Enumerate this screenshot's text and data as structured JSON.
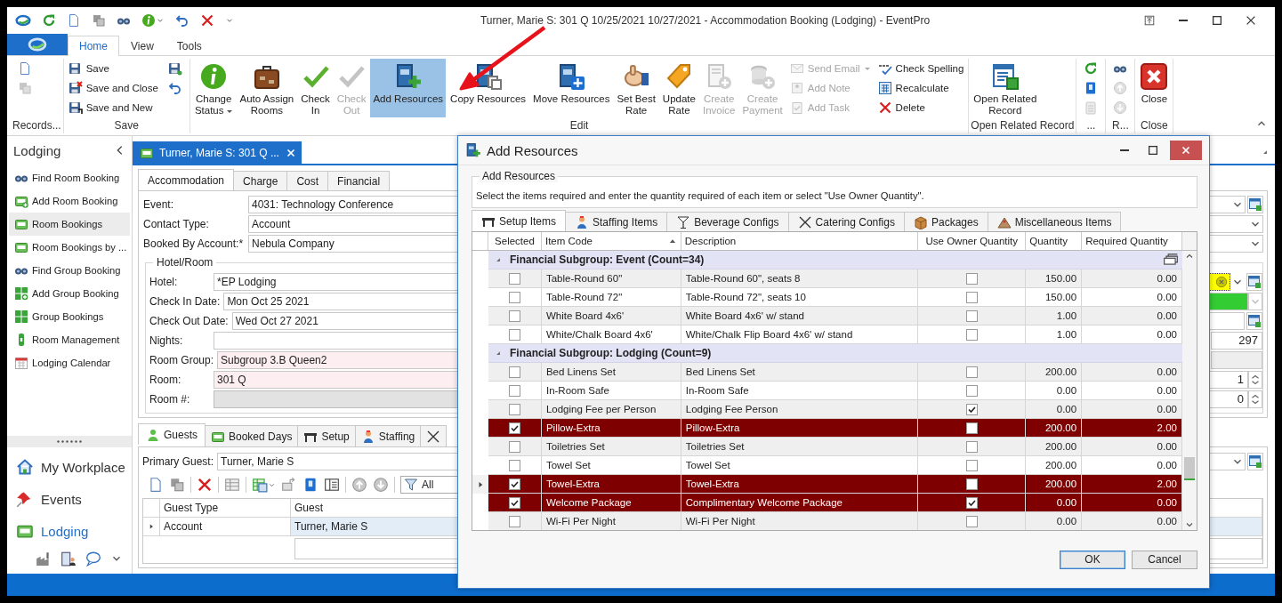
{
  "window": {
    "title": "Turner, Marie S: 301 Q 10/25/2021 10/27/2021 - Accommodation Booking (Lodging) - EventPro"
  },
  "ribbon_tabs": [
    {
      "label": "Home",
      "selected": true
    },
    {
      "label": "View",
      "selected": false
    },
    {
      "label": "Tools",
      "selected": false
    }
  ],
  "ribbon_groups": [
    {
      "label": "Records...",
      "columns": [
        [
          {
            "kind": "icon",
            "disabled": false
          },
          {
            "kind": "icon",
            "disabled": true
          }
        ]
      ]
    },
    {
      "label": "Save",
      "columns": [
        [
          {
            "kind": "small",
            "label": "Save",
            "disabled": false,
            "dropdown": false
          },
          {
            "kind": "small",
            "label": "Save and Close",
            "disabled": false,
            "dropdown": false
          },
          {
            "kind": "small",
            "label": "Save and New",
            "disabled": false,
            "dropdown": false
          }
        ],
        [
          {
            "kind": "icon",
            "disabled": false
          },
          {
            "kind": "icon",
            "disabled": false
          }
        ]
      ]
    },
    {
      "label": "Edit",
      "columns": [
        [
          {
            "kind": "large",
            "lines": [
              "Change",
              "Status"
            ],
            "disabled": false,
            "dropdown": true,
            "highlighted": false
          }
        ],
        [
          {
            "kind": "large",
            "lines": [
              "Auto Assign",
              "Rooms"
            ],
            "disabled": false,
            "dropdown": false,
            "highlighted": false
          }
        ],
        [
          {
            "kind": "large",
            "lines": [
              "Check",
              "In"
            ],
            "disabled": false,
            "dropdown": false,
            "highlighted": false
          }
        ],
        [
          {
            "kind": "large",
            "lines": [
              "Check",
              "Out"
            ],
            "disabled": true,
            "dropdown": false,
            "highlighted": false
          }
        ],
        [
          {
            "kind": "large",
            "lines": [
              "Add Resources"
            ],
            "disabled": false,
            "dropdown": false,
            "highlighted": true
          }
        ],
        [
          {
            "kind": "large",
            "lines": [
              "Copy Resources"
            ],
            "disabled": false,
            "dropdown": false,
            "highlighted": false
          }
        ],
        [
          {
            "kind": "large",
            "lines": [
              "Move Resources"
            ],
            "disabled": false,
            "dropdown": false,
            "highlighted": false
          }
        ],
        [
          {
            "kind": "large",
            "lines": [
              "Set Best",
              "Rate"
            ],
            "disabled": false,
            "dropdown": false,
            "highlighted": false
          }
        ],
        [
          {
            "kind": "large",
            "lines": [
              "Update",
              "Rate"
            ],
            "disabled": false,
            "dropdown": false,
            "highlighted": false
          }
        ],
        [
          {
            "kind": "large",
            "lines": [
              "Create",
              "Invoice"
            ],
            "disabled": true,
            "dropdown": false,
            "highlighted": false
          }
        ],
        [
          {
            "kind": "large",
            "lines": [
              "Create",
              "Payment"
            ],
            "disabled": true,
            "dropdown": false,
            "highlighted": false
          }
        ],
        [
          {
            "kind": "small",
            "label": "Send Email",
            "disabled": true,
            "dropdown": true
          },
          {
            "kind": "small",
            "label": "Add Note",
            "disabled": true,
            "dropdown": false
          },
          {
            "kind": "small",
            "label": "Add Task",
            "disabled": true,
            "dropdown": false
          }
        ],
        [
          {
            "kind": "small",
            "label": "Check Spelling",
            "disabled": false,
            "dropdown": false
          },
          {
            "kind": "small",
            "label": "Recalculate",
            "disabled": false,
            "dropdown": false
          },
          {
            "kind": "small",
            "label": "Delete",
            "disabled": false,
            "dropdown": false
          }
        ]
      ]
    },
    {
      "label": "Open Related Record",
      "columns": [
        [
          {
            "kind": "large",
            "lines": [
              "Open Related",
              "Record"
            ],
            "disabled": false,
            "dropdown": false,
            "highlighted": false
          }
        ]
      ]
    },
    {
      "label": "...",
      "columns": [
        [
          {
            "kind": "icon",
            "disabled": false
          },
          {
            "kind": "icon",
            "disabled": false
          },
          {
            "kind": "icon",
            "disabled": true
          }
        ]
      ]
    },
    {
      "label": "R...",
      "columns": [
        [
          {
            "kind": "icon",
            "disabled": false
          },
          {
            "kind": "icon",
            "disabled": true
          },
          {
            "kind": "icon",
            "disabled": true
          }
        ]
      ]
    },
    {
      "label": "Close",
      "columns": [
        [
          {
            "kind": "large",
            "lines": [
              "Close"
            ],
            "disabled": false,
            "dropdown": false,
            "highlighted": false
          }
        ]
      ]
    }
  ],
  "sidebar": {
    "title": "Lodging",
    "items": [
      {
        "label": "Find Room Booking",
        "selected": false
      },
      {
        "label": "Add Room Booking",
        "selected": false
      },
      {
        "label": "Room Bookings",
        "selected": true
      },
      {
        "label": "Room Bookings by ...",
        "selected": false
      },
      {
        "label": "Find Group Booking",
        "selected": false
      },
      {
        "label": "Add Group Booking",
        "selected": false
      },
      {
        "label": "Group Bookings",
        "selected": false
      },
      {
        "label": "Room Management",
        "selected": false
      },
      {
        "label": "Lodging Calendar",
        "selected": false
      }
    ],
    "nav": [
      {
        "label": "My Workplace",
        "selected": false
      },
      {
        "label": "Events",
        "selected": false
      },
      {
        "label": "Lodging",
        "selected": true
      }
    ]
  },
  "document_tab": {
    "label": "Turner, Marie S: 301 Q ..."
  },
  "form_tabs": [
    {
      "label": "Accommodation",
      "selected": true
    },
    {
      "label": "Charge",
      "selected": false
    },
    {
      "label": "Cost",
      "selected": false
    },
    {
      "label": "Financial",
      "selected": false
    }
  ],
  "fields": [
    {
      "label": "Event:",
      "value": "4031: Technology Conference",
      "kind": "combo-lookup",
      "required": false,
      "disabled": false
    },
    {
      "label": "Contact Type:",
      "value": "Account",
      "kind": "combo",
      "required": false,
      "disabled": false
    },
    {
      "label": "Booked By Account:*",
      "value": "Nebula Company",
      "kind": "combo",
      "required": false,
      "disabled": false
    }
  ],
  "hotel_room": {
    "title": "Hotel/Room",
    "fields": [
      {
        "label": "Hotel:",
        "value": "*EP Lodging",
        "kind": "status-lookup",
        "color": "#ffff00",
        "required": false,
        "disabled": false
      },
      {
        "label": "Check In Date:",
        "value": "Mon Oct 25 2021",
        "kind": "status",
        "color": "#33cc33",
        "required": false,
        "disabled": false
      },
      {
        "label": "Check Out Date:",
        "value": "Wed Oct 27 2021",
        "kind": "lookup",
        "required": false,
        "disabled": false
      },
      {
        "label": "Nights:",
        "kind": "number",
        "side_value": "297",
        "required": false,
        "disabled": false
      },
      {
        "label": "Room Group:",
        "value": "Subgroup 3.B Queen2",
        "kind": "readonly",
        "required": true,
        "disabled": false
      },
      {
        "label": "Room:",
        "value": "301 Q",
        "kind": "spin",
        "side_value": "1",
        "required": true,
        "disabled": false
      },
      {
        "label": "Room #:",
        "kind": "spin",
        "side_value": "0",
        "required": false,
        "disabled": true
      }
    ]
  },
  "detail_tabs": [
    {
      "label": "Guests",
      "selected": true
    },
    {
      "label": "Booked Days",
      "selected": false
    },
    {
      "label": "Setup",
      "selected": false
    },
    {
      "label": "Staffing",
      "selected": false
    },
    {
      "selected": false
    }
  ],
  "primary_guest": {
    "label": "Primary Guest:",
    "value": "Turner, Marie S"
  },
  "guest_filter": {
    "label": "All"
  },
  "guests_table": {
    "columns": [
      "Guest Type",
      "Guest"
    ],
    "rows": [
      {
        "cells": [
          "Account",
          "Turner, Marie S"
        ],
        "selected": true
      }
    ]
  },
  "dialog": {
    "title": "Add Resources",
    "group_title": "Add Resources",
    "instruction": "Select the items required and enter the quantity required of each item or select \"Use Owner Quantity\".",
    "tabs": [
      {
        "label": "Setup Items",
        "selected": true
      },
      {
        "label": "Staffing Items",
        "selected": false
      },
      {
        "label": "Beverage Configs",
        "selected": false
      },
      {
        "label": "Catering Configs",
        "selected": false
      },
      {
        "label": "Packages",
        "selected": false
      },
      {
        "label": "Miscellaneous Items",
        "selected": false
      }
    ],
    "columns": [
      {
        "label": "Selected",
        "sorted": false
      },
      {
        "label": "Item Code",
        "sorted": true
      },
      {
        "label": "Description",
        "sorted": false
      },
      {
        "label": "Use Owner Quantity",
        "sorted": false
      },
      {
        "label": "Quantity",
        "sorted": false
      },
      {
        "label": "Required Quantity",
        "sorted": false
      }
    ],
    "groups": [
      {
        "label": "Financial Subgroup: Event (Count=34)",
        "expanded": true,
        "rows": [
          {
            "code": "Table-Round 60\"",
            "description": "Table-Round 60\", seats 8",
            "selected": false,
            "use_owner": false,
            "quantity": "150.00",
            "required": "0.00",
            "focused": false
          },
          {
            "code": "Table-Round 72\"",
            "description": "Table-Round 72\", seats 10",
            "selected": false,
            "use_owner": false,
            "quantity": "150.00",
            "required": "0.00",
            "focused": false
          },
          {
            "code": "White Board 4x6'",
            "description": "White Board 4x6' w/ stand",
            "selected": false,
            "use_owner": false,
            "quantity": "1.00",
            "required": "0.00",
            "focused": false
          },
          {
            "code": "White/Chalk Board 4x6'",
            "description": "White/Chalk Flip Board 4x6' w/ stand",
            "selected": false,
            "use_owner": false,
            "quantity": "1.00",
            "required": "0.00",
            "focused": false
          }
        ]
      },
      {
        "label": "Financial Subgroup: Lodging (Count=9)",
        "expanded": true,
        "rows": [
          {
            "code": "Bed Linens Set",
            "description": "Bed Linens Set",
            "selected": false,
            "use_owner": false,
            "quantity": "200.00",
            "required": "0.00",
            "focused": false
          },
          {
            "code": "In-Room Safe",
            "description": "In-Room Safe",
            "selected": false,
            "use_owner": false,
            "quantity": "0.00",
            "required": "0.00",
            "focused": false
          },
          {
            "code": "Lodging Fee per Person",
            "description": "Lodging Fee Person",
            "selected": false,
            "use_owner": true,
            "quantity": "0.00",
            "required": "0.00",
            "focused": false
          },
          {
            "code": "Pillow-Extra",
            "description": "Pillow-Extra",
            "selected": true,
            "use_owner": false,
            "quantity": "200.00",
            "required": "2.00",
            "focused": false
          },
          {
            "code": "Toiletries Set",
            "description": "Toiletries Set",
            "selected": false,
            "use_owner": false,
            "quantity": "200.00",
            "required": "0.00",
            "focused": false
          },
          {
            "code": "Towel Set",
            "description": "Towel Set",
            "selected": false,
            "use_owner": false,
            "quantity": "200.00",
            "required": "0.00",
            "focused": false
          },
          {
            "code": "Towel-Extra",
            "description": "Towel-Extra",
            "selected": true,
            "use_owner": false,
            "quantity": "200.00",
            "required": "2.00",
            "focused": true
          },
          {
            "code": "Welcome Package",
            "description": "Complimentary Welcome Package",
            "selected": true,
            "use_owner": true,
            "quantity": "0.00",
            "required": "0.00",
            "focused": false
          },
          {
            "code": "Wi-Fi Per Night",
            "description": "Wi-Fi Per Night",
            "selected": false,
            "use_owner": false,
            "quantity": "0.00",
            "required": "0.00",
            "focused": false
          }
        ]
      }
    ],
    "buttons": [
      {
        "label": "OK",
        "default": true
      },
      {
        "label": "Cancel",
        "default": false
      }
    ]
  }
}
